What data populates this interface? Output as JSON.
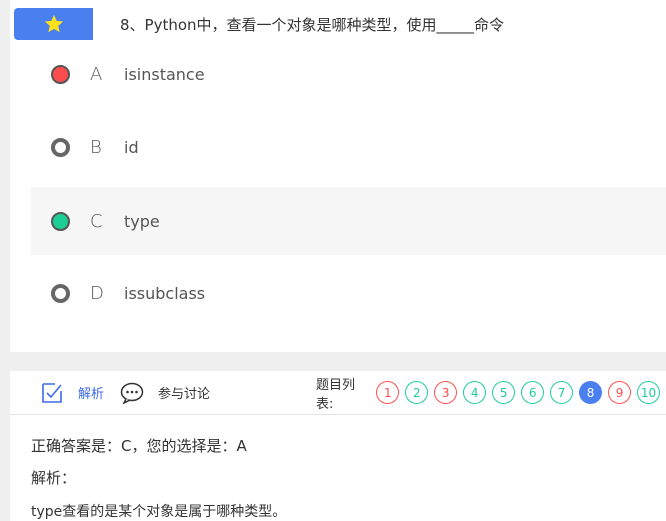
{
  "question": {
    "title": "8、Python中，查看一个对象是哪种类型，使用_____命令",
    "options": [
      {
        "letter": "A",
        "text": "isinstance",
        "state": "wrong"
      },
      {
        "letter": "B",
        "text": "id",
        "state": "empty"
      },
      {
        "letter": "C",
        "text": "type",
        "state": "correct"
      },
      {
        "letter": "D",
        "text": "issubclass",
        "state": "empty"
      }
    ]
  },
  "tabs": {
    "analysis_label": "解析",
    "discuss_label": "参与讨论"
  },
  "question_list": {
    "label": "题目列表:",
    "items": [
      {
        "num": "1",
        "status": "wrong"
      },
      {
        "num": "2",
        "status": "right"
      },
      {
        "num": "3",
        "status": "wrong"
      },
      {
        "num": "4",
        "status": "right"
      },
      {
        "num": "5",
        "status": "right"
      },
      {
        "num": "6",
        "status": "right"
      },
      {
        "num": "7",
        "status": "right"
      },
      {
        "num": "8",
        "status": "current"
      },
      {
        "num": "9",
        "status": "wrong"
      },
      {
        "num": "10",
        "status": "right"
      }
    ]
  },
  "result": {
    "answer_line": "正确答案是：C，您的选择是：A",
    "analysis_label": "解析：",
    "analysis_text": "type查看的是某个对象是属于哪种类型。"
  },
  "colors": {
    "accent": "#4a7ff0",
    "wrong": "#ff4d4f",
    "correct": "#1ecf95"
  }
}
